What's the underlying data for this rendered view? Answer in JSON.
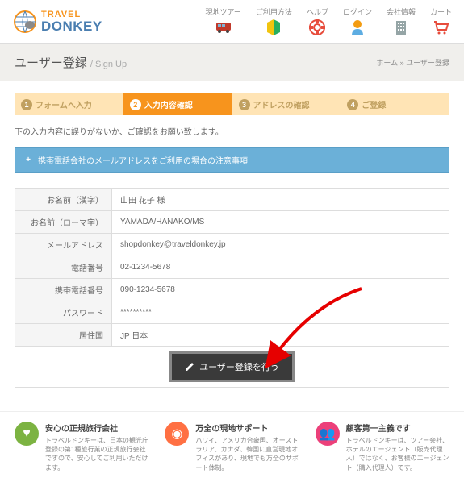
{
  "logo": {
    "line1": "TRAVEL",
    "line2": "DONKEY"
  },
  "nav": [
    {
      "label": "現地ツアー"
    },
    {
      "label": "ご利用方法"
    },
    {
      "label": "ヘルプ"
    },
    {
      "label": "ログイン"
    },
    {
      "label": "会社情報"
    },
    {
      "label": "カート"
    }
  ],
  "page": {
    "title": "ユーザー登録",
    "subtitle": "/ Sign Up"
  },
  "breadcrumb": {
    "home": "ホーム",
    "sep": " » ",
    "current": "ユーザー登録"
  },
  "steps": [
    {
      "num": "1",
      "label": "フォームへ入力"
    },
    {
      "num": "2",
      "label": "入力内容確認"
    },
    {
      "num": "3",
      "label": "アドレスの確認"
    },
    {
      "num": "4",
      "label": "ご登録"
    }
  ],
  "instruction": "下の入力内容に誤りがないか、ご確認をお願い致します。",
  "notice": "携帯電話会社のメールアドレスをご利用の場合の注意事項",
  "form": [
    {
      "label": "お名前（漢字）",
      "value": "山田 花子 様"
    },
    {
      "label": "お名前（ローマ字）",
      "value": "YAMADA/HANAKO/MS"
    },
    {
      "label": "メールアドレス",
      "value": "shopdonkey@traveldonkey.jp"
    },
    {
      "label": "電話番号",
      "value": "02-1234-5678"
    },
    {
      "label": "携帯電話番号",
      "value": "090-1234-5678"
    },
    {
      "label": "パスワード",
      "value": "**********"
    },
    {
      "label": "居住国",
      "value": "JP 日本"
    }
  ],
  "submit": "ユーザー登録を行う",
  "features": [
    {
      "title": "安心の正規旅行会社",
      "desc": "トラベルドンキーは、日本の観光庁登録の第1種旅行業の正規旅行会社ですので、安心してご利用いただけます。"
    },
    {
      "title": "万全の現地サポート",
      "desc": "ハワイ、アメリカ合衆国、オーストラリア、カナダ、韓国に直営現地オフィスがあり、現地でも万全のサポート体制。"
    },
    {
      "title": "顧客第一主義です",
      "desc": "トラベルドンキーは、ツアー会社、ホテルのエージェント（販売代理人）ではなく、お客様のエージェント（購入代理人）です。"
    }
  ]
}
